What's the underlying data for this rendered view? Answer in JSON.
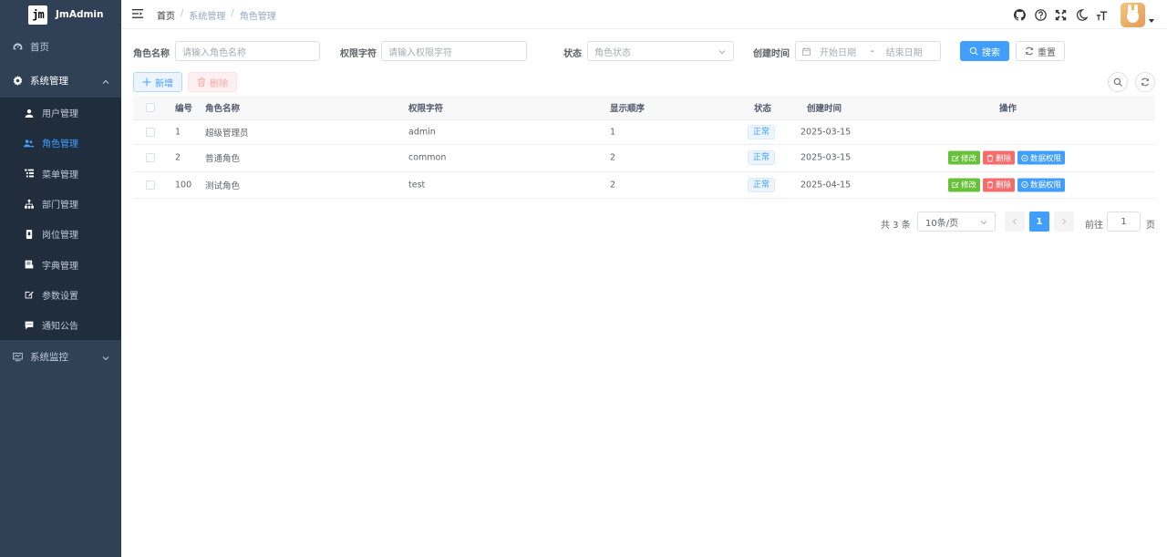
{
  "app": {
    "logo_mark": "jm",
    "name": "JmAdmin"
  },
  "sidebar": {
    "items": [
      {
        "label": "首页",
        "icon": "dashboard-icon"
      },
      {
        "label": "系统管理",
        "icon": "gear-icon",
        "expanded": true,
        "children": [
          {
            "label": "用户管理",
            "icon": "user-icon"
          },
          {
            "label": "角色管理",
            "icon": "users-icon",
            "active": true
          },
          {
            "label": "菜单管理",
            "icon": "tree-table-icon"
          },
          {
            "label": "部门管理",
            "icon": "org-tree-icon"
          },
          {
            "label": "岗位管理",
            "icon": "post-icon"
          },
          {
            "label": "字典管理",
            "icon": "dict-icon"
          },
          {
            "label": "参数设置",
            "icon": "edit-icon"
          },
          {
            "label": "通知公告",
            "icon": "message-icon"
          }
        ]
      },
      {
        "label": "系统监控",
        "icon": "monitor-icon",
        "expanded": false
      }
    ]
  },
  "navbar": {
    "breadcrumb": [
      "首页",
      "系统管理",
      "角色管理"
    ],
    "icons": [
      "github-icon",
      "question-icon",
      "fullscreen-icon",
      "moon-icon",
      "font-size-icon"
    ]
  },
  "search": {
    "role_name_label": "角色名称",
    "role_name_placeholder": "请输入角色名称",
    "role_key_label": "权限字符",
    "role_key_placeholder": "请输入权限字符",
    "status_label": "状态",
    "status_placeholder": "角色状态",
    "created_label": "创建时间",
    "start_placeholder": "开始日期",
    "range_sep": "-",
    "end_placeholder": "结束日期",
    "search_button": "搜索",
    "reset_button": "重置"
  },
  "toolbar": {
    "add_button": "新增",
    "delete_button": "删除"
  },
  "table": {
    "headers": {
      "id": "编号",
      "name": "角色名称",
      "key": "权限字符",
      "sort": "显示顺序",
      "status": "状态",
      "created": "创建时间",
      "ops": "操作"
    },
    "rows": [
      {
        "id": "1",
        "name": "超级管理员",
        "key": "admin",
        "sort": "1",
        "status": "正常",
        "created": "2025-03-15",
        "has_ops": false
      },
      {
        "id": "2",
        "name": "普通角色",
        "key": "common",
        "sort": "2",
        "status": "正常",
        "created": "2025-03-15",
        "has_ops": true
      },
      {
        "id": "100",
        "name": "测试角色",
        "key": "test",
        "sort": "2",
        "status": "正常",
        "created": "2025-04-15",
        "has_ops": true
      }
    ],
    "ops": {
      "edit": "修改",
      "delete": "删除",
      "data_scope": "数据权限"
    }
  },
  "pagination": {
    "total_text": "共 3 条",
    "page_size": "10条/页",
    "current_page": "1",
    "goto_label": "前往",
    "goto_value": "1",
    "page_suffix": "页"
  },
  "colors": {
    "sidebar_bg": "#304156",
    "submenu_bg": "#1f2d3d",
    "primary": "#409eff",
    "success": "#67c23a",
    "danger": "#f56c6c"
  }
}
